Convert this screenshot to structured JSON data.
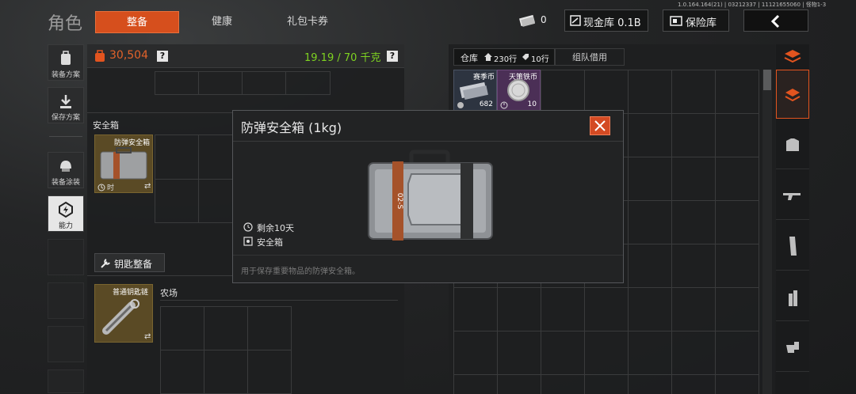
{
  "version_info": "1.0.164.164(21) | 03212337 | 11121655060 | 怪物1-3",
  "header": {
    "title": "角色",
    "tabs": [
      {
        "label": "整备",
        "active": true
      },
      {
        "label": "健康",
        "active": false
      },
      {
        "label": "礼包卡券",
        "active": false
      }
    ],
    "ticket_count": "0",
    "cash_vault_label": "现金库 0.1B",
    "safe_vault_label": "保险库"
  },
  "sidebar": {
    "items": [
      {
        "label": "装备方案"
      },
      {
        "label": "保存方案"
      },
      {
        "label": "装备涂装"
      },
      {
        "label": "能力"
      }
    ]
  },
  "loadout": {
    "value": "30,504",
    "weight": "19.19 / 70 千克",
    "help": "?",
    "safe_box_section": "安全箱",
    "safe_box_item": {
      "name": "防弹安全箱",
      "time_tag": "时"
    },
    "key_section_button": "钥匙整备",
    "key_item": {
      "name": "普通钥匙链"
    },
    "key_location": "农场"
  },
  "warehouse": {
    "tab_label": "仓库",
    "rows_label": "230行",
    "rows2_label": "10行",
    "team_loan_label": "组队借用",
    "items": [
      {
        "name": "赛季币",
        "count": "682"
      },
      {
        "name": "天策铁币",
        "count": "10"
      }
    ]
  },
  "modal": {
    "title": "防弹安全箱 (1kg)",
    "remaining": "剩余10天",
    "type": "安全箱",
    "description": "用于保存重要物品的防弹安全箱。",
    "case_text": "02-S"
  },
  "colors": {
    "accent_orange": "#e2541f",
    "weight_green": "#7ed321",
    "value_orange": "#e2622a",
    "close_red": "#d44a23"
  }
}
